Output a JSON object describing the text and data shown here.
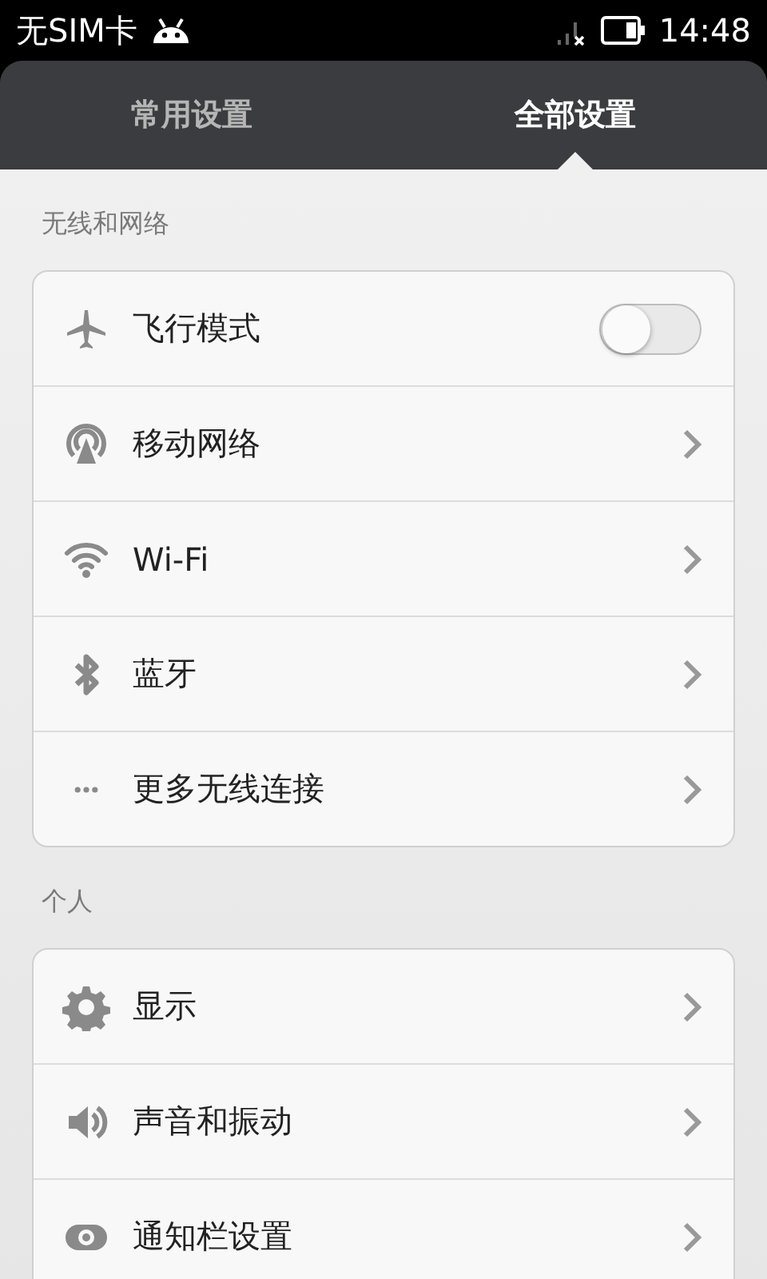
{
  "status_bar": {
    "carrier": "无SIM卡",
    "time": "14:48"
  },
  "tabs": [
    {
      "label": "常用设置",
      "selected": false
    },
    {
      "label": "全部设置",
      "selected": true
    }
  ],
  "sections": [
    {
      "title": "无线和网络",
      "items": [
        {
          "label": "飞行模式",
          "kind": "toggle",
          "on": false
        },
        {
          "label": "移动网络",
          "kind": "link"
        },
        {
          "label": "Wi-Fi",
          "kind": "link"
        },
        {
          "label": "蓝牙",
          "kind": "link"
        },
        {
          "label": "更多无线连接",
          "kind": "link"
        }
      ]
    },
    {
      "title": "个人",
      "items": [
        {
          "label": "显示",
          "kind": "link"
        },
        {
          "label": "声音和振动",
          "kind": "link"
        },
        {
          "label": "通知栏设置",
          "kind": "link"
        }
      ]
    }
  ]
}
